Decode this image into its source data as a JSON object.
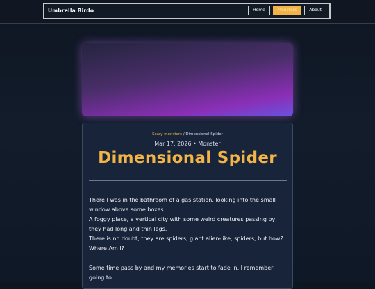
{
  "header": {
    "brand": "Umbrella Birdo",
    "nav": [
      {
        "label": "Home",
        "active": false
      },
      {
        "label": "Monsters",
        "active": true
      },
      {
        "label": "About",
        "active": false
      }
    ],
    "accent_color": "#f2b447"
  },
  "post": {
    "breadcrumb": {
      "parent": "Scary monsters",
      "separator": "/",
      "current": "Dimensional Spider"
    },
    "meta": "Mar 17, 2026 • Monster",
    "title": "Dimensional Spider",
    "paragraphs": [
      "There I was in the bathroom of a gas station, looking into the small window above some boxes.",
      "A foggy place, a vertical city with some weird creatures passing by, they had long and thin legs.",
      "There is no doubt, they are spiders, giant alien-like, spiders, but how? Where Am I?",
      "Some time pass by and my memories start to fade in, I remember going to"
    ]
  }
}
